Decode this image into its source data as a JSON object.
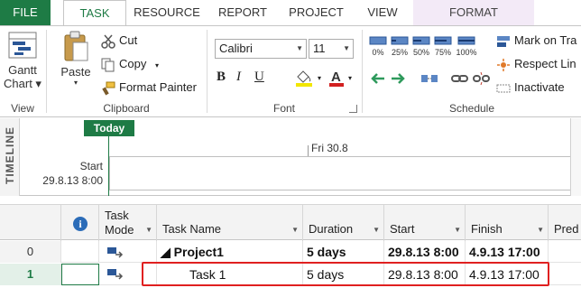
{
  "tabs": {
    "file": "FILE",
    "task": "TASK",
    "resource": "RESOURCE",
    "report": "REPORT",
    "project": "PROJECT",
    "view": "VIEW",
    "format": "FORMAT"
  },
  "ribbon": {
    "view_group": {
      "label": "View",
      "gantt_chart_line1": "Gantt",
      "gantt_chart_line2": "Chart ▾"
    },
    "clipboard_group": {
      "label": "Clipboard",
      "paste": "Paste",
      "cut": "Cut",
      "copy": "Copy",
      "format_painter": "Format Painter"
    },
    "font_group": {
      "label": "Font",
      "font_name": "Calibri",
      "font_size": "11",
      "bold": "B",
      "italic": "I",
      "underline": "U"
    },
    "schedule_group": {
      "label": "Schedule",
      "percent_buttons": [
        "0%",
        "25%",
        "50%",
        "75%",
        "100%"
      ],
      "mark_on_track": "Mark on Tra",
      "respect_links": "Respect Lin",
      "inactivate": "Inactivate"
    }
  },
  "timeline": {
    "label": "TIMELINE",
    "today": "Today",
    "date_marker": "Fri 30.8",
    "start_label": "Start",
    "start_date": "29.8.13 8:00"
  },
  "grid": {
    "headers": {
      "info": "i",
      "task_mode_line1": "Task",
      "task_mode_line2": "Mode",
      "task_name": "Task Name",
      "duration": "Duration",
      "start": "Start",
      "finish": "Finish",
      "predecessors": "Pred"
    },
    "rows": [
      {
        "id": "0",
        "name": "◢ Project1",
        "duration": "5 days",
        "start": "29.8.13 8:00",
        "finish": "4.9.13 17:00"
      },
      {
        "id": "1",
        "name": "Task 1",
        "duration": "5 days",
        "start": "29.8.13 8:00",
        "finish": "4.9.13 17:00"
      }
    ]
  },
  "colors": {
    "accent_green": "#1e7b45",
    "highlight_red": "#e02020",
    "format_tab_bg": "#f3eaf7"
  }
}
